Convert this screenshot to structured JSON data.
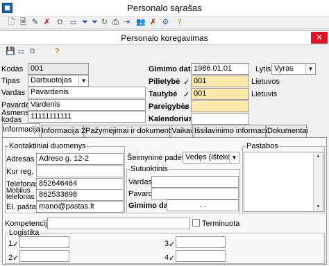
{
  "window": {
    "title": "Personalo sąrašas"
  },
  "dialog": {
    "title": "Personalo koregavimas",
    "close": "✕"
  },
  "toolbar1": [
    {
      "name": "new-doc-icon",
      "glyph": "🗋"
    },
    {
      "name": "open-doc-icon",
      "glyph": "🗎"
    },
    {
      "name": "edit-icon",
      "glyph": "✎"
    },
    {
      "name": "delete-icon",
      "glyph": "✗"
    },
    {
      "name": "copy-icon",
      "glyph": "⧉"
    },
    {
      "name": "tree-icon",
      "glyph": "⚏"
    },
    {
      "name": "filter-icon",
      "glyph": "⏷"
    },
    {
      "name": "filter-clear-icon",
      "glyph": "⏷"
    },
    {
      "name": "refresh-icon",
      "glyph": "↻"
    },
    {
      "name": "print-icon",
      "glyph": "⎙"
    },
    {
      "name": "export-icon",
      "glyph": "⇥"
    },
    {
      "name": "users-icon",
      "glyph": "👥"
    },
    {
      "name": "user-remove-icon",
      "glyph": "✗"
    },
    {
      "name": "settings-icon",
      "glyph": "⚙"
    },
    {
      "name": "help-icon",
      "glyph": "?"
    }
  ],
  "form": {
    "kodas_label": "Kodas",
    "kodas": "001",
    "tipas_label": "Tipas",
    "tipas": "Darbuotojas",
    "vardas_label": "Vardas",
    "vardas": "Pavardenis",
    "pavarde_label": "Pavardė",
    "pavarde": "Vardenis",
    "asmens_kodas_label": "Asmens kodas",
    "asmens_kodas": "11111111111",
    "gimimo_data_label": "Gimimo data",
    "gimimo_data": "1986.01.01",
    "lytis_label": "Lytis",
    "lytis": "Vyras",
    "pilietybe_label": "Pilietybė",
    "pilietybe_code": "001",
    "pilietybe": "Lietuvos",
    "tautybe_label": "Tautybė",
    "tautybe_code": "001",
    "tautybe": "Lietuvis",
    "pareigybes_label": "Pareigybės",
    "pareigybes": "",
    "kalendorius_label": "Kalendorius",
    "kalendorius": ""
  },
  "tabs": [
    "Informacija",
    "Informacija 2",
    "Pažymėjimai ir dokumentai",
    "Vaikai",
    "Išsilavinimo informacija",
    "Dokumentai"
  ],
  "contacts": {
    "group_label": "Kontaktiniai duomenys",
    "adresas_label": "Adresas",
    "adresas": "Adreso g. 12-2",
    "kur_reg_label": "Kur reg.",
    "kur_reg": "",
    "telefonas_label": "Telefonas",
    "telefonas": "852646464",
    "mobilus_label": "Mobilus telefonas",
    "mobilus": "862533698",
    "el_pastas_label": "El. paštas",
    "el_pastas": "mano@pastas.lt"
  },
  "family": {
    "seimynine_label": "Šeimyninė padėtis",
    "seimynine": "Vedęs (ištekėju",
    "sutuoktinis_label": "Sutuoktinis",
    "vardas_label": "Vardas",
    "vardas": "",
    "pavarde_label": "Pavardė",
    "pavarde": "",
    "gimimo_data_label": "Gimimo data",
    "gimimo_data": ". ."
  },
  "notes": {
    "label": "Pastabos",
    "value": ""
  },
  "kompetencija": {
    "label": "Kompetencija",
    "value": "",
    "terminuota_label": "Terminuota",
    "terminuota": false
  },
  "logistika": {
    "label": "Logistika",
    "n1": "1",
    "n2": "2",
    "n3": "3",
    "n4": "4"
  }
}
